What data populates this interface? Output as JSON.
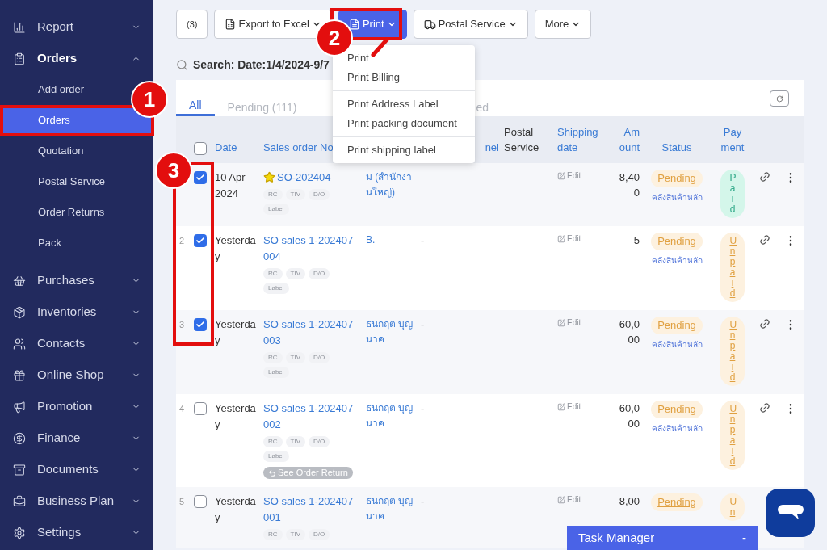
{
  "sidebar": {
    "items": [
      {
        "label": "Report",
        "expanded": false
      },
      {
        "label": "Orders",
        "expanded": true,
        "children": [
          {
            "label": "Add order",
            "selected": false
          },
          {
            "label": "Orders",
            "selected": true
          },
          {
            "label": "Quotation",
            "selected": false
          },
          {
            "label": "Postal Service",
            "selected": false
          },
          {
            "label": "Order Returns",
            "selected": false
          },
          {
            "label": "Pack",
            "selected": false
          }
        ]
      },
      {
        "label": "Purchases",
        "expanded": false
      },
      {
        "label": "Inventories",
        "expanded": false
      },
      {
        "label": "Contacts",
        "expanded": false
      },
      {
        "label": "Online Shop",
        "expanded": false
      },
      {
        "label": "Promotion",
        "expanded": false
      },
      {
        "label": "Finance",
        "expanded": false
      },
      {
        "label": "Documents",
        "expanded": false
      },
      {
        "label": "Business Plan",
        "expanded": false
      },
      {
        "label": "Settings",
        "expanded": false
      }
    ]
  },
  "toolbar": {
    "buttons": [
      {
        "label": "(3)",
        "kind": "count",
        "open": false
      },
      {
        "label": "Export to Excel",
        "kind": "excel",
        "open": false
      },
      {
        "label": "Print",
        "kind": "print",
        "open": true
      },
      {
        "label": "Postal Service",
        "kind": "truck",
        "open": false
      },
      {
        "label": "More",
        "kind": "plain",
        "open": false
      }
    ]
  },
  "search": {
    "label": "Search: Date:1/4/2024-9/7"
  },
  "print_menu": {
    "groups": [
      [
        "Print",
        "Print Billing"
      ],
      [
        "Print Address Label",
        "Print packing document"
      ],
      [
        "Print shipping label"
      ]
    ]
  },
  "tabs": [
    {
      "label": "All",
      "selected": true
    },
    {
      "label": "Pending (111)",
      "selected": false
    },
    {
      "label": "ed",
      "selected": false
    }
  ],
  "table": {
    "select_all": false,
    "columns": [
      {
        "label": "Date",
        "sortable": true
      },
      {
        "label": "Sales order No",
        "sortable": true
      },
      {
        "label": "nel",
        "sortable": true
      },
      {
        "label": "Postal Service",
        "sortable": false
      },
      {
        "label": "Shipping date",
        "sortable": true
      },
      {
        "label": "Am ount",
        "sortable": true
      },
      {
        "label": "Status",
        "sortable": true
      },
      {
        "label": "Pay ment",
        "sortable": true
      }
    ],
    "rows": [
      {
        "checked": true,
        "date": "10 Apr 2024",
        "starred": true,
        "order_no": "SO-202404",
        "tags": [
          "RC",
          "TIV",
          "D/O",
          "Label"
        ],
        "customer": "ม (สำนักงานใหญ่)",
        "edit": "Edit",
        "amount": "8,400",
        "status": "Pending",
        "warehouse": "คลังสินค้าหลัก",
        "payment": {
          "label": "Paid",
          "kind": "paid"
        }
      },
      {
        "number": "2",
        "checked": true,
        "date": "Yesterday",
        "starred": false,
        "order_no": "SO sales 1-202407004",
        "tags": [
          "RC",
          "TIV",
          "D/O",
          "Label"
        ],
        "customer": "B.",
        "channel": "-",
        "edit": "Edit",
        "amount": "5",
        "status": "Pending",
        "warehouse": "คลังสินค้าหลัก",
        "payment": {
          "label": "Unpaid",
          "kind": "unpaid"
        }
      },
      {
        "number": "3",
        "checked": true,
        "date": "Yesterday",
        "starred": false,
        "order_no": "SO sales 1-202407003",
        "tags": [
          "RC",
          "TIV",
          "D/O",
          "Label"
        ],
        "customer": "ธนกฤต บุญนาค",
        "channel": "-",
        "edit": "Edit",
        "amount": "60,000",
        "status": "Pending",
        "warehouse": "คลังสินค้าหลัก",
        "payment": {
          "label": "Unpaid",
          "kind": "unpaid"
        }
      },
      {
        "number": "4",
        "checked": false,
        "date": "Yesterday",
        "starred": false,
        "order_no": "SO sales 1-202407002",
        "tags": [
          "RC",
          "TIV",
          "D/O",
          "Label"
        ],
        "return_link": "See Order Return",
        "customer": "ธนกฤต บุญนาค",
        "channel": "-",
        "edit": "Edit",
        "amount": "60,000",
        "status": "Pending",
        "warehouse": "คลังสินค้าหลัก",
        "payment": {
          "label": "Unpaid",
          "kind": "unpaid"
        }
      },
      {
        "number": "5",
        "checked": false,
        "date": "Yesterday",
        "starred": false,
        "order_no": "SO sales 1-202407001",
        "tags": [
          "RC",
          "TIV",
          "D/O"
        ],
        "customer": "ธนกฤต บุญนาค",
        "channel": "-",
        "edit": "Edit",
        "amount": "8,00",
        "status": "Pending",
        "payment": {
          "label": "Un",
          "kind": "unpaid"
        }
      }
    ]
  },
  "task_manager": {
    "title": "Task Manager",
    "toggle": "-"
  },
  "callouts": [
    {
      "number": "1"
    },
    {
      "number": "2"
    },
    {
      "number": "3"
    }
  ]
}
